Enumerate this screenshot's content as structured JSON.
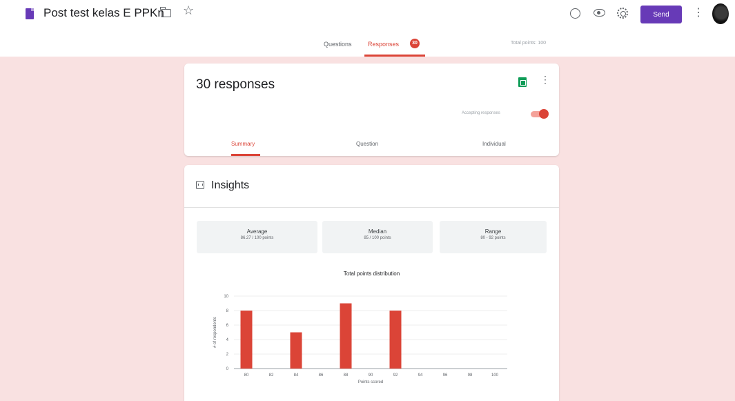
{
  "header": {
    "doc_title": "Post test kelas E PPKn",
    "send_label": "Send",
    "more_icon": "more-vert-icon",
    "icons": [
      "folder-icon",
      "star-icon",
      "palette-icon",
      "eye-icon",
      "gear-icon"
    ]
  },
  "tabs": {
    "questions_label": "Questions",
    "responses_label": "Responses",
    "responses_badge": "30",
    "total_points": "Total points: 100"
  },
  "responses_card": {
    "count": "30 responses",
    "accepting_label": "Accepting responses",
    "accepting": true,
    "subtabs": {
      "summary": "Summary",
      "question": "Question",
      "individual": "Individual"
    }
  },
  "insights": {
    "title": "Insights",
    "average": {
      "label": "Average",
      "value": "86.27 / 100 points"
    },
    "median": {
      "label": "Median",
      "value": "85 / 100 points"
    },
    "range": {
      "label": "Range",
      "value": "80 - 92 points"
    }
  },
  "colors": {
    "accent": "#db4437",
    "brand": "#673ab7",
    "background": "#f9e1e1"
  },
  "chart_data": {
    "type": "bar",
    "title": "Total points distribution",
    "xlabel": "Points scored",
    "ylabel": "# of respondents",
    "categories": [
      "80",
      "82",
      "84",
      "86",
      "88",
      "90",
      "92",
      "94",
      "96",
      "98",
      "100"
    ],
    "values": [
      8,
      0,
      5,
      0,
      9,
      0,
      8,
      0,
      0,
      0,
      0
    ],
    "yticks": [
      0,
      2,
      4,
      6,
      8,
      10
    ],
    "ylim": [
      0,
      10
    ],
    "grid": true,
    "color": "#db4437"
  }
}
